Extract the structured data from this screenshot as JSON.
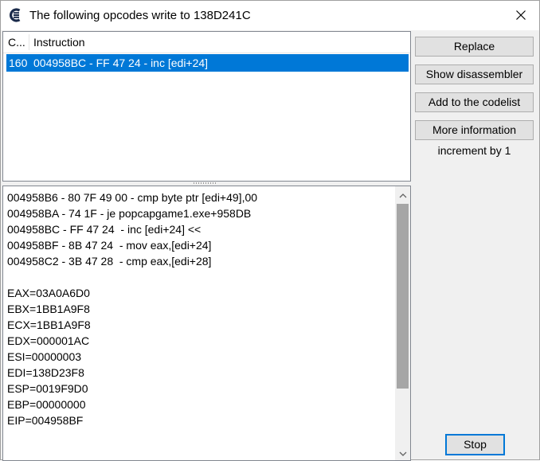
{
  "window": {
    "title": "The following opcodes write to 138D241C",
    "app_icon": "cheat-engine-icon",
    "close_icon": "close-icon"
  },
  "listview": {
    "columns": [
      "C...",
      "Instruction"
    ],
    "rows": [
      {
        "count": "160",
        "instruction": "004958BC - FF 47 24  - inc [edi+24]",
        "selected": true
      }
    ]
  },
  "buttons": {
    "replace": "Replace",
    "show_disassembler": "Show disassembler",
    "add_to_codelist": "Add to the codelist",
    "more_information": "More information",
    "stop": "Stop"
  },
  "info_label": "increment by 1",
  "details": {
    "lines": [
      "004958B6 - 80 7F 49 00 - cmp byte ptr [edi+49],00",
      "004958BA - 74 1F - je popcapgame1.exe+958DB",
      "004958BC - FF 47 24  - inc [edi+24] <<",
      "004958BF - 8B 47 24  - mov eax,[edi+24]",
      "004958C2 - 3B 47 28  - cmp eax,[edi+28]",
      "",
      "EAX=03A0A6D0",
      "EBX=1BB1A9F8",
      "ECX=1BB1A9F8",
      "EDX=000001AC",
      "ESI=00000003",
      "EDI=138D23F8",
      "ESP=0019F9D0",
      "EBP=00000000",
      "EIP=004958BF"
    ]
  },
  "colors": {
    "selection": "#0078d7",
    "button_face": "#e1e1e1",
    "dialog_bg": "#f0f0f0"
  }
}
